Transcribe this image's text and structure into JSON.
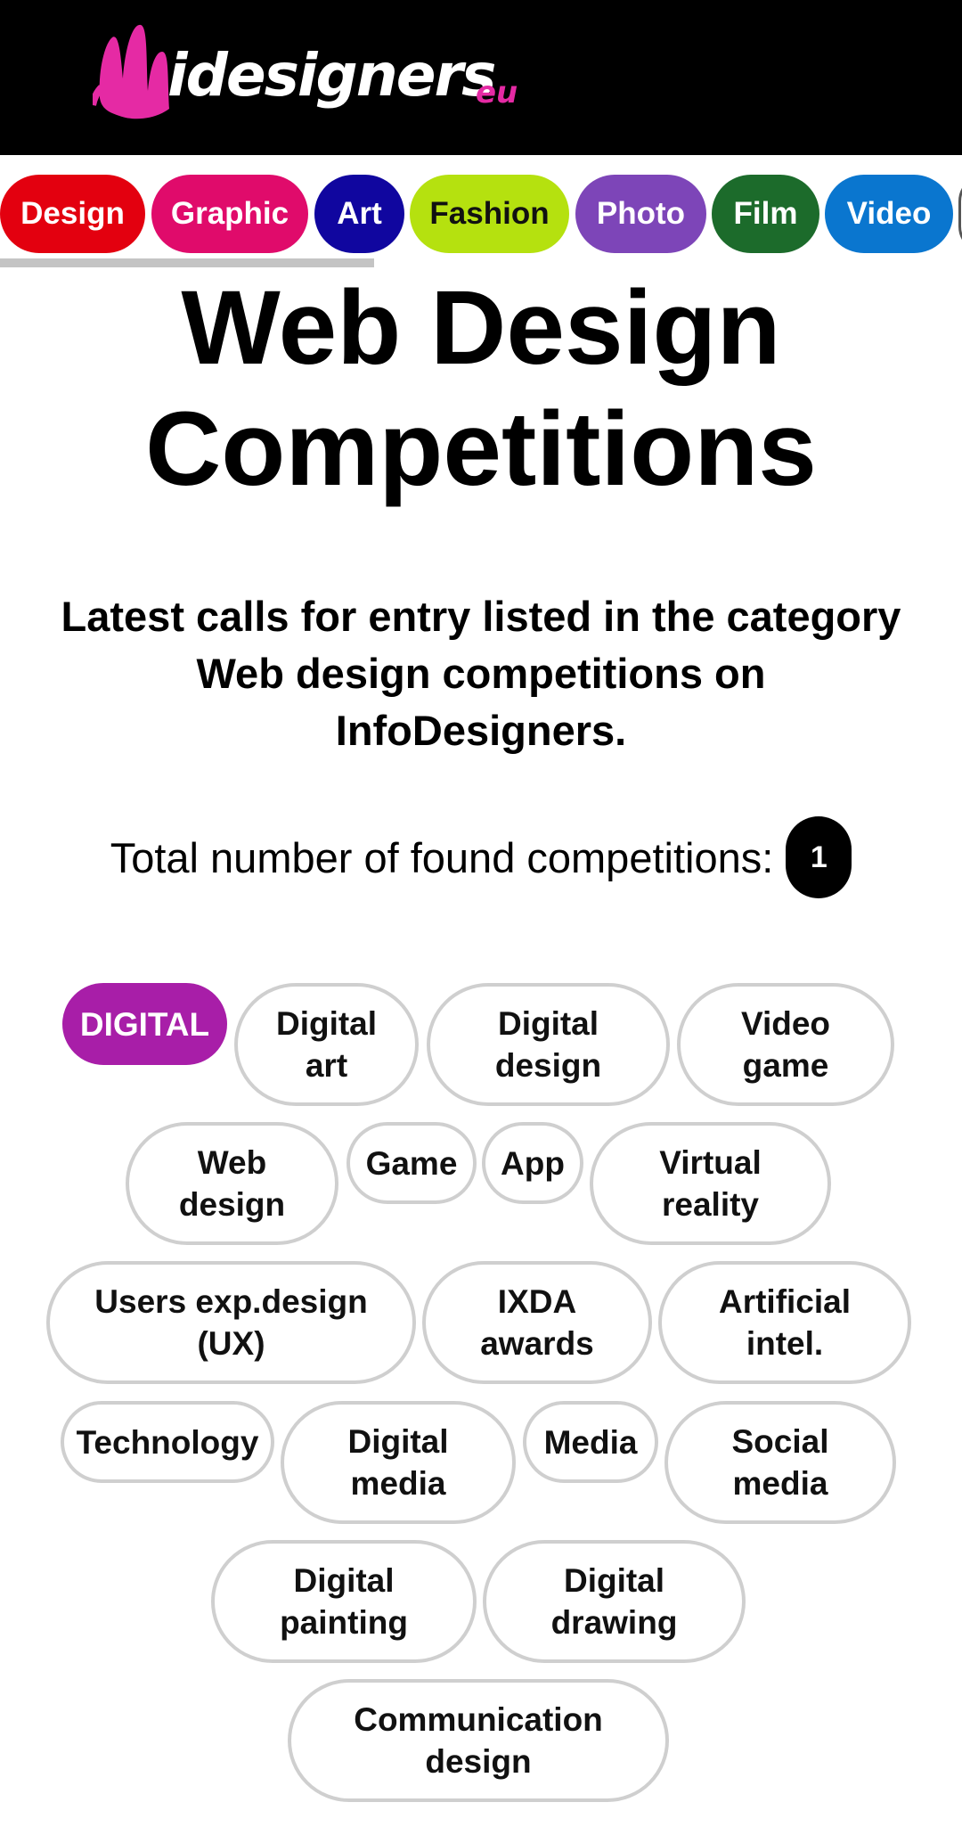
{
  "brand": {
    "name": "idesigners",
    "suffix": "eu",
    "accent": "#e52aa4"
  },
  "categories": [
    {
      "label": "Design",
      "color": "#e3000f"
    },
    {
      "label": "Graphic",
      "color": "#e00b6b"
    },
    {
      "label": "Art",
      "color": "#10069f"
    },
    {
      "label": "Fashion",
      "color": "#b5e10f"
    },
    {
      "label": "Photo",
      "color": "#7d45b8"
    },
    {
      "label": "Film",
      "color": "#1c6b2b"
    },
    {
      "label": "Video",
      "color": "#0a76cf"
    }
  ],
  "page": {
    "title_line1": "Web Design",
    "title_line2": "Competitions",
    "subtitle": "Latest calls for entry listed in the category Web design competitions on InfoDesigners.",
    "total_label": "Total number of found competitions:",
    "total_count": "1"
  },
  "tags": [
    "DIGITAL",
    "Digital art",
    "Digital design",
    "Video game",
    "Web design",
    "Game",
    "App",
    "Virtual reality",
    "Users exp.design (UX)",
    "IXDA awards",
    "Artificial intel.",
    "Technology",
    "Digital media",
    "Media",
    "Social media",
    "Digital painting",
    "Digital drawing",
    "Communication design"
  ],
  "colors": {
    "active_tag": "#a81ea8",
    "tag_border": "#cfcfcf"
  }
}
